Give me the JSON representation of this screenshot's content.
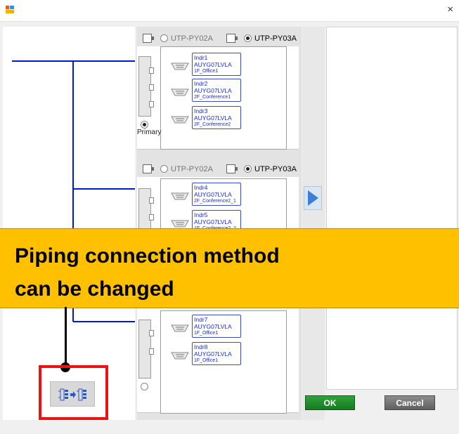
{
  "window": {
    "close_glyph": "×",
    "app_icon": "app-icon"
  },
  "groups": [
    {
      "option_a": "UTP-PY02A",
      "option_b": "UTP-PY03A",
      "selected": "UTP-PY03A",
      "units": [
        {
          "name": "Indr1",
          "model": "AUYG07LVLA",
          "location": "1F_Office1"
        },
        {
          "name": "Indr2",
          "model": "AUYG07LVLA",
          "location": "2F_Conference1"
        },
        {
          "name": "Indr3",
          "model": "AUYG07LVLA",
          "location": "2F_Conference2"
        }
      ],
      "bottom_label": "Primary",
      "bottom_selected": true
    },
    {
      "option_a": "UTP-PY02A",
      "option_b": "UTP-PY03A",
      "selected": "UTP-PY03A",
      "units": [
        {
          "name": "Indr4",
          "model": "AUYG07LVLA",
          "location": "2F_Conference2_1"
        },
        {
          "name": "Indr5",
          "model": "AUYG07LVLA",
          "location": "1F_Conference2_2"
        }
      ]
    },
    {
      "units": [
        {
          "name": "Indr7",
          "model": "AUYG07LVLA",
          "location": "1F_Office1"
        },
        {
          "name": "Indr8",
          "model": "AUYG07LVLA",
          "location": "1F_Office1"
        }
      ],
      "bottom_selected": false
    }
  ],
  "callout": {
    "line1": "Piping connection method",
    "line2": "can be changed",
    "color": "#ffc000"
  },
  "buttons": {
    "ok": "OK",
    "cancel": "Cancel"
  },
  "switch_button_icon": "piping-switch-icon",
  "colors": {
    "pipe_line": "#0018d8",
    "unit_text": "#1a2ad6",
    "highlight": "#ee1111",
    "ok": "#1f8f2c"
  }
}
